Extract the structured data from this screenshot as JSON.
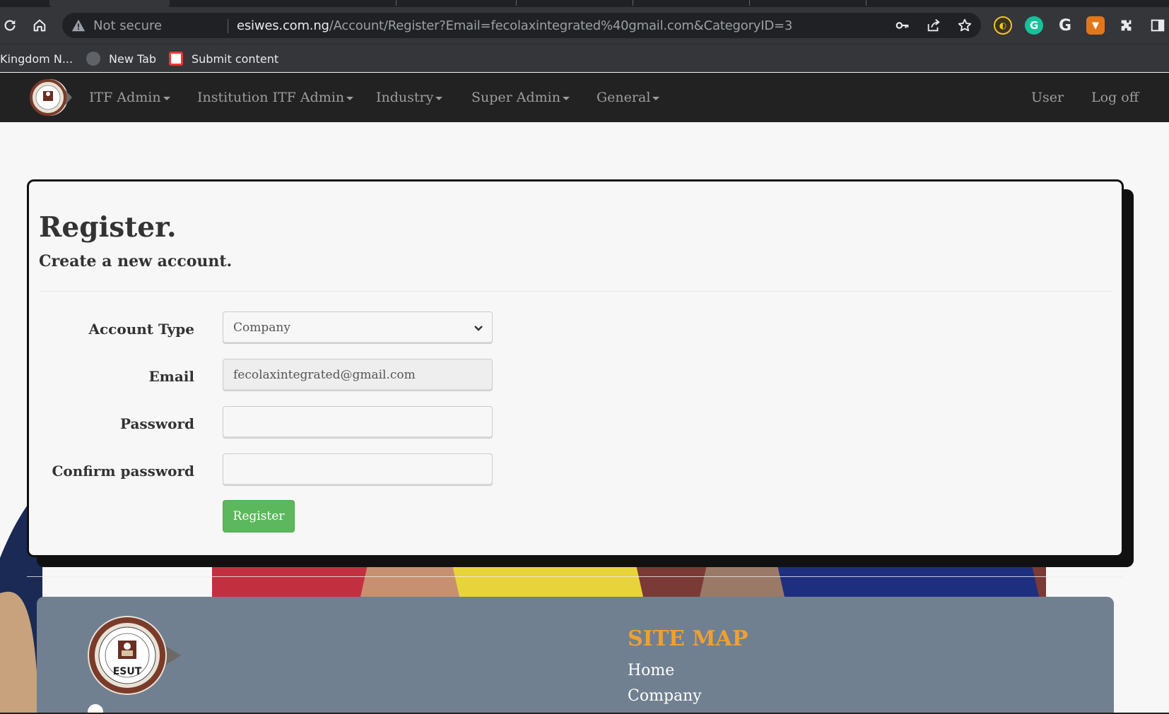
{
  "browser": {
    "omnibox": {
      "security_label": "Not secure",
      "url_host": "esiwes.com.ng",
      "url_path": "/Account/Register?Email=fecolaxintegrated%40gmail.com&CategoryID=3"
    },
    "bookmarks": [
      {
        "label": "Kingdom N..."
      },
      {
        "label": "New Tab"
      },
      {
        "label": "Submit content"
      }
    ]
  },
  "nav": {
    "menus": [
      {
        "label": "ITF Admin"
      },
      {
        "label": "Institution ITF Admin"
      },
      {
        "label": "Industry"
      },
      {
        "label": "Super Admin"
      },
      {
        "label": "General"
      }
    ],
    "user_label": "User",
    "logoff_label": "Log off"
  },
  "register": {
    "title": "Register.",
    "subtitle": "Create a new account.",
    "account_type_label": "Account Type",
    "account_type_value": "Company",
    "email_label": "Email",
    "email_value": "fecolaxintegrated@gmail.com",
    "password_label": "Password",
    "password_value": "",
    "confirm_label": "Confirm password",
    "confirm_value": "",
    "submit_label": "Register"
  },
  "footer": {
    "logo_text": "ESUT",
    "sitemap_title": "SITE MAP",
    "links": [
      {
        "label": "Home"
      },
      {
        "label": "Company"
      }
    ]
  },
  "colors": {
    "navbar_bg": "#222222",
    "register_button": "#5cb85c",
    "footer_bg": "#708090",
    "sitemap_accent": "#f0a030"
  }
}
